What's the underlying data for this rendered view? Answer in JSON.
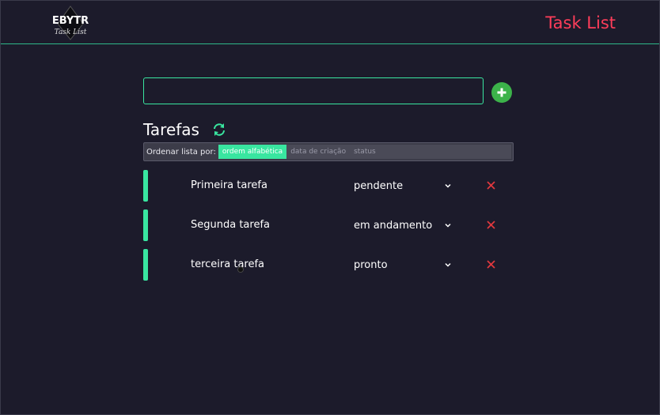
{
  "header": {
    "logo_text": "EBYTR",
    "logo_subtext": "Task List",
    "title": "Task List"
  },
  "new_task": {
    "value": "",
    "placeholder": "",
    "add_icon": "plus-circle-icon"
  },
  "tasks_section": {
    "title": "Tarefas",
    "refresh_icon": "refresh-icon"
  },
  "sort": {
    "label": "Ordenar lista por:",
    "options": [
      "ordem alfabética",
      "data de criação",
      "status"
    ],
    "selected": "ordem alfabética"
  },
  "tasks": [
    {
      "name": "Primeira tarefa",
      "status": "pendente"
    },
    {
      "name": "Segunda tarefa",
      "status": "em andamento"
    },
    {
      "name": "terceira tarefa",
      "status": "pronto"
    }
  ],
  "colors": {
    "background": "#1c1b2b",
    "accent": "#39e6a0",
    "title_red": "#ff3d5a",
    "add_green": "#3cb34a",
    "delete_red": "#e0383e"
  }
}
